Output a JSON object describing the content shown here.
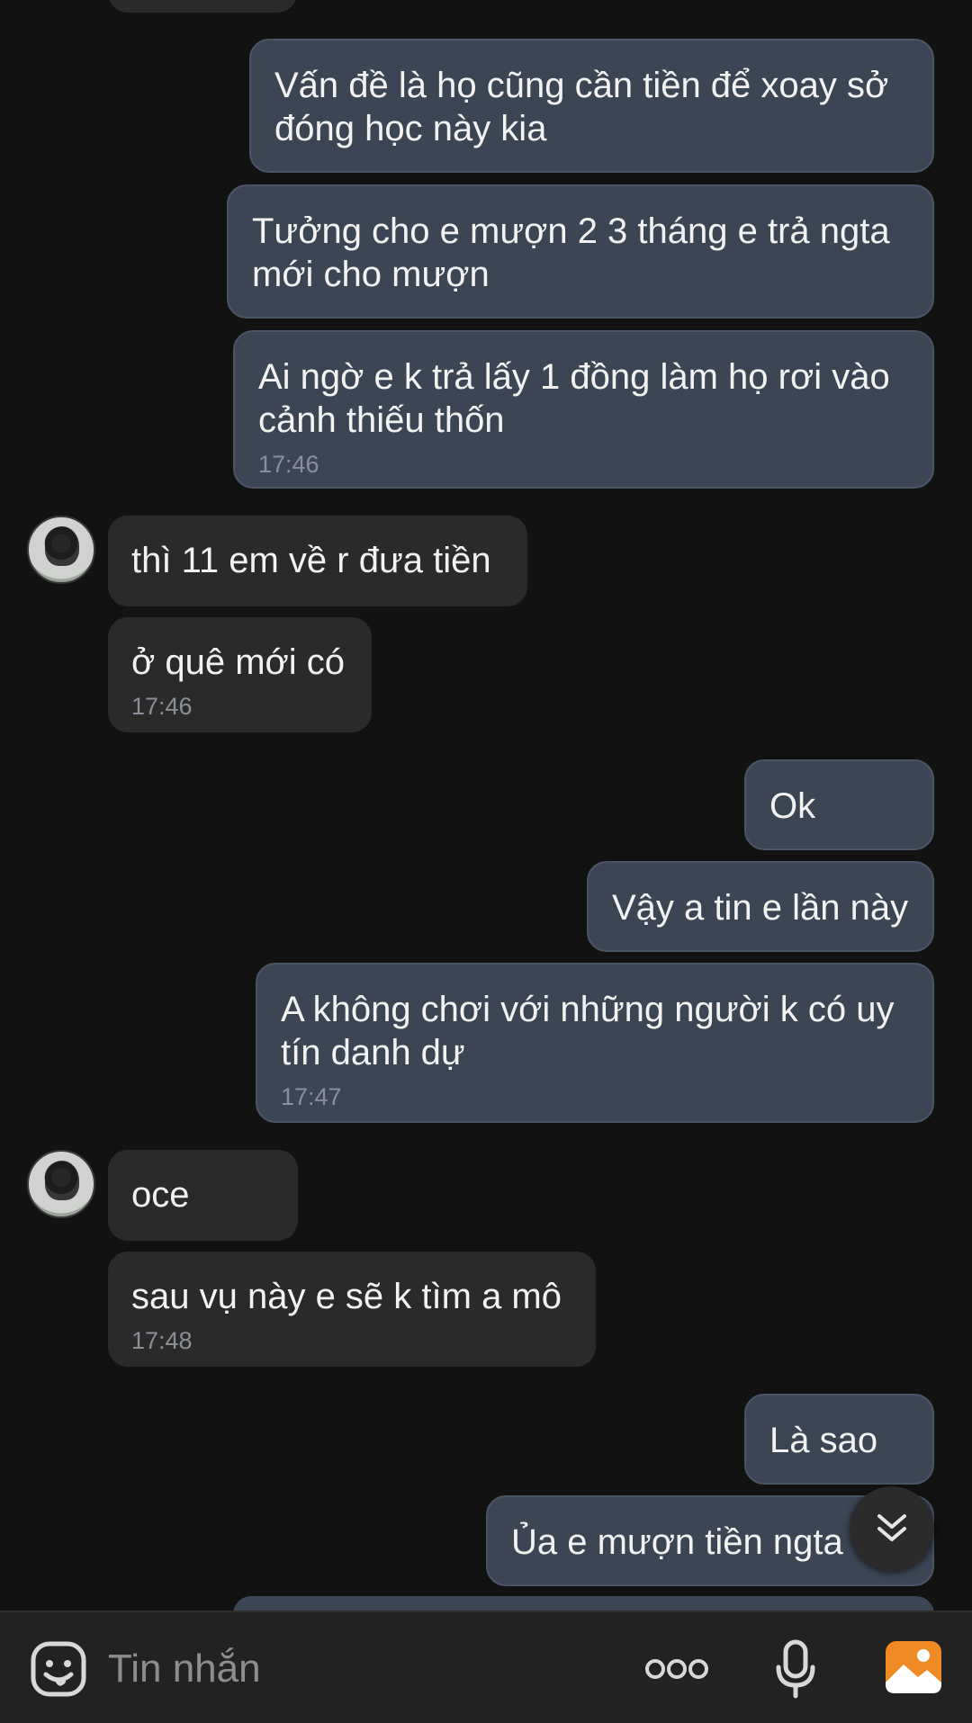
{
  "messages": [
    {
      "text": "Vấn đề là họ cũng cần tiền để xoay sở đóng học này kia"
    },
    {
      "text": "Tưởng cho e mượn 2 3 tháng e trả ngta mới cho mượn"
    },
    {
      "text": "Ai ngờ e k trả lấy 1 đồng làm họ rơi vào cảnh thiếu thốn",
      "time": "17:46"
    },
    {
      "text": "thì 11 em về r đưa tiền"
    },
    {
      "text": "ở quê mới có",
      "time": "17:46"
    },
    {
      "text": "Ok"
    },
    {
      "text": "Vậy a tin e lần này"
    },
    {
      "text": "A không chơi với những người k có uy tín danh dự",
      "time": "17:47"
    },
    {
      "text": "oce"
    },
    {
      "text": "sau vụ này e sẽ k tìm a mô",
      "time": "17:48"
    },
    {
      "text": "Là sao"
    },
    {
      "text": "Ủa e mượn tiền ngta"
    }
  ],
  "composer": {
    "placeholder": "Tin nhắn",
    "sticker_icon": "sticker-icon",
    "more_icon": "more-options-icon",
    "mic_icon": "microphone-icon",
    "image_icon": "image-icon",
    "image_icon_color": "#f08a24"
  },
  "colors": {
    "background": "#121212",
    "outgoing_bubble": "#3b4554",
    "incoming_bubble": "#2a2a2a"
  }
}
